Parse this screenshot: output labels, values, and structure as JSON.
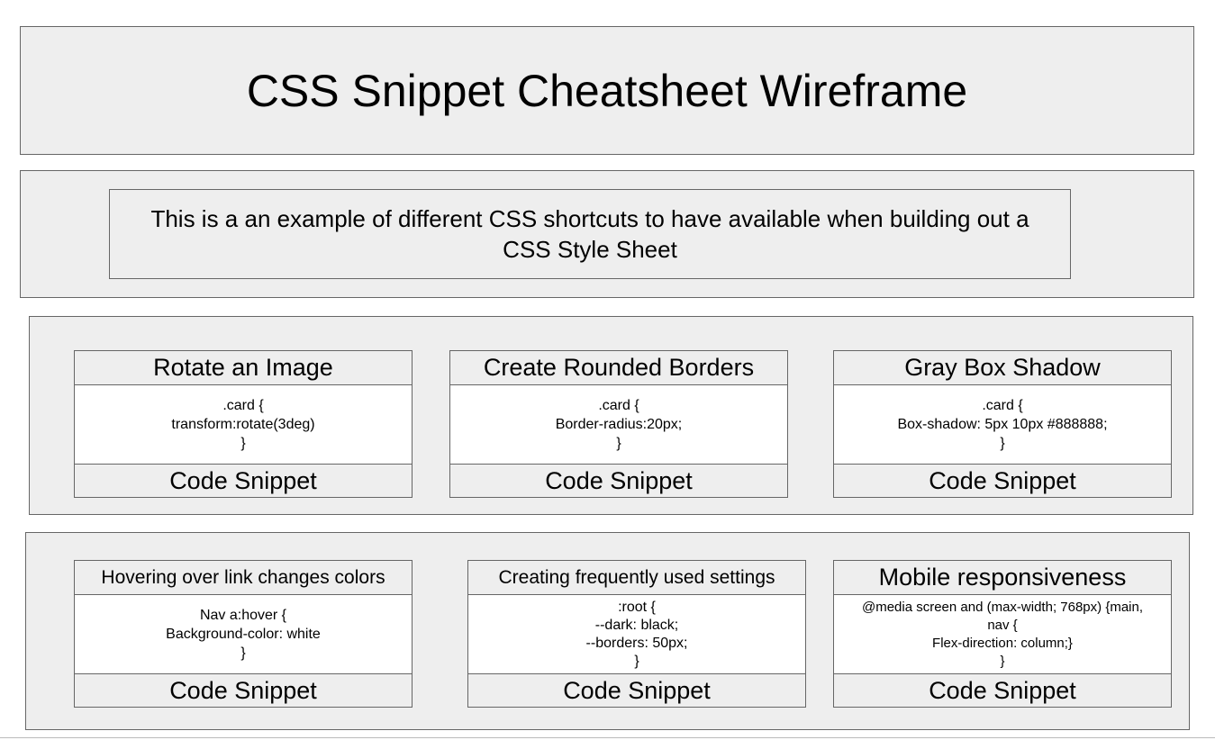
{
  "title": "CSS Snippet Cheatsheet Wireframe",
  "intro": "This is a an example of different CSS shortcuts to have available when building out a CSS Style Sheet",
  "rows": [
    {
      "cards": [
        {
          "heading": "Rotate an Image",
          "code": [
            ".card {",
            "transform:rotate(3deg)",
            "}"
          ],
          "footer": "Code Snippet"
        },
        {
          "heading": "Create Rounded Borders",
          "code": [
            ".card {",
            "Border-radius:20px;",
            "}"
          ],
          "footer": "Code Snippet"
        },
        {
          "heading": "Gray Box Shadow",
          "code": [
            ".card {",
            "Box-shadow: 5px 10px #888888;",
            "}"
          ],
          "footer": "Code Snippet"
        }
      ]
    },
    {
      "cards": [
        {
          "heading": "Hovering over link changes colors",
          "code": [
            "Nav a:hover {",
            "Background-color: white",
            "}"
          ],
          "footer": "Code Snippet"
        },
        {
          "heading": "Creating frequently used settings",
          "code": [
            ":root {",
            "--dark: black;",
            "--borders: 50px;",
            "}"
          ],
          "footer": "Code Snippet"
        },
        {
          "heading": "Mobile responsiveness",
          "code": [
            "@media screen and (max-width; 768px) {main,",
            "nav {",
            "Flex-direction: column;}",
            "}"
          ],
          "footer": "Code Snippet"
        }
      ]
    }
  ]
}
